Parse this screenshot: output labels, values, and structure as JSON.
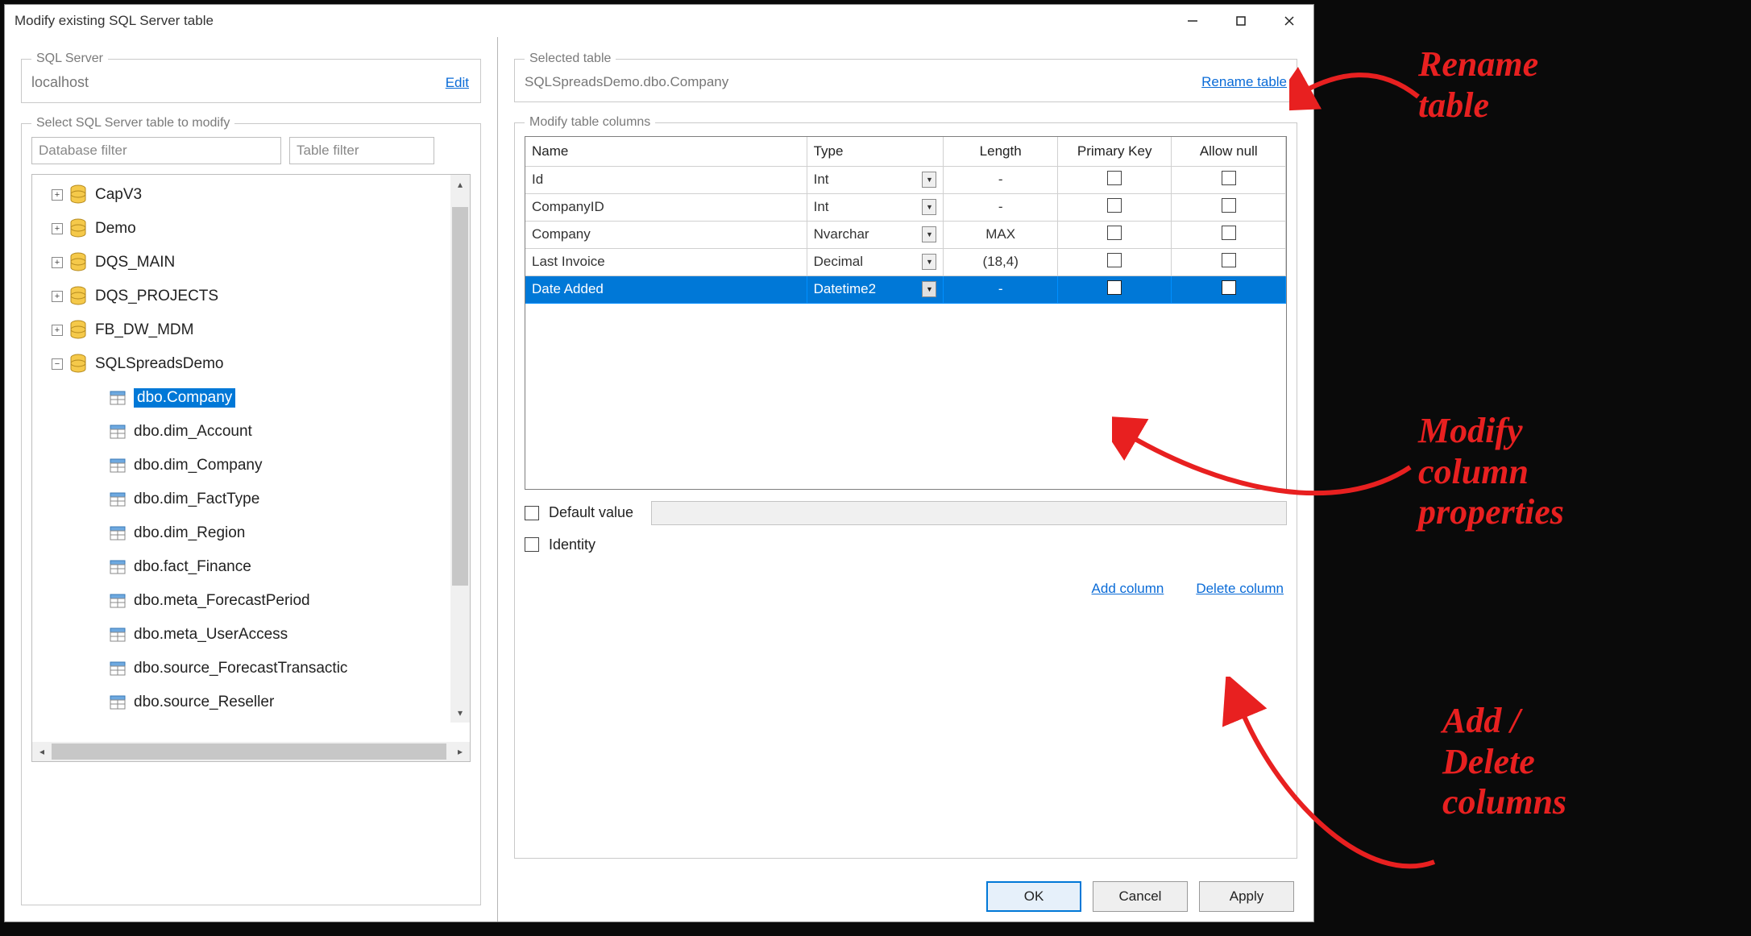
{
  "window": {
    "title": "Modify existing SQL Server table"
  },
  "left": {
    "server_legend": "SQL Server",
    "server_name": "localhost",
    "edit": "Edit",
    "select_legend": "Select SQL Server table to modify",
    "db_filter_ph": "Database filter",
    "tbl_filter_ph": "Table filter",
    "tree": {
      "CapV3": "CapV3",
      "Demo": "Demo",
      "DQS_MAIN": "DQS_MAIN",
      "DQS_PROJECTS": "DQS_PROJECTS",
      "FB_DW_MDM": "FB_DW_MDM",
      "SQLSpreadsDemo": "SQLSpreadsDemo",
      "tables": {
        "t0": "dbo.Company",
        "t1": "dbo.dim_Account",
        "t2": "dbo.dim_Company",
        "t3": "dbo.dim_FactType",
        "t4": "dbo.dim_Region",
        "t5": "dbo.fact_Finance",
        "t6": "dbo.meta_ForecastPeriod",
        "t7": "dbo.meta_UserAccess",
        "t8": "dbo.source_ForecastTransactic",
        "t9": "dbo.source_Reseller"
      }
    }
  },
  "right": {
    "selected_legend": "Selected table",
    "selected_name": "SQLSpreadsDemo.dbo.Company",
    "rename": "Rename table",
    "columns_legend": "Modify table columns",
    "headers": {
      "name": "Name",
      "type": "Type",
      "length": "Length",
      "pk": "Primary Key",
      "allownull": "Allow null"
    },
    "rows": [
      {
        "name": "Id",
        "type": "Int",
        "length": "-",
        "pk": false,
        "null": false,
        "sel": false
      },
      {
        "name": "CompanyID",
        "type": "Int",
        "length": "-",
        "pk": false,
        "null": false,
        "sel": false
      },
      {
        "name": "Company",
        "type": "Nvarchar",
        "length": "MAX",
        "pk": false,
        "null": false,
        "sel": false
      },
      {
        "name": "Last Invoice",
        "type": "Decimal",
        "length": "(18,4)",
        "pk": false,
        "null": false,
        "sel": false
      },
      {
        "name": "Date Added",
        "type": "Datetime2",
        "length": "-",
        "pk": false,
        "null": false,
        "sel": true
      }
    ],
    "default_label": "Default value",
    "identity_label": "Identity",
    "add_column": "Add column",
    "delete_column": "Delete column",
    "ok": "OK",
    "cancel": "Cancel",
    "apply": "Apply"
  },
  "annotations": {
    "a1": "Rename\ntable",
    "a2": "Modify\ncolumn\nproperties",
    "a3": "Add /\nDelete\ncolumns"
  }
}
